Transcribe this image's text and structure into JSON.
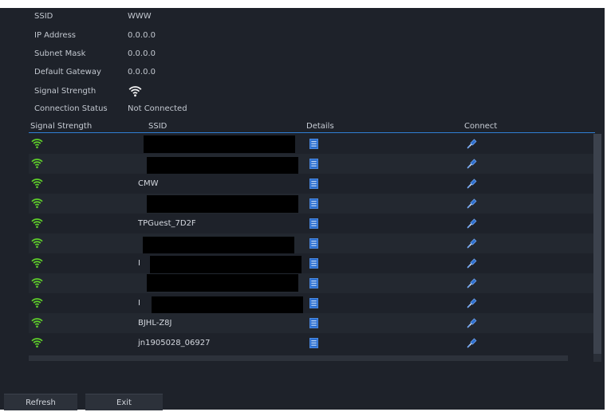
{
  "info": [
    {
      "label": "SSID",
      "value": "WWW"
    },
    {
      "label": "IP Address",
      "value": "0.0.0.0"
    },
    {
      "label": "Subnet Mask",
      "value": "0.0.0.0"
    },
    {
      "label": "Default Gateway",
      "value": "0.0.0.0"
    },
    {
      "label": "Signal Strength",
      "value": ""
    },
    {
      "label": "Connection Status",
      "value": "Not Connected"
    }
  ],
  "table": {
    "columns": [
      "Signal Strength",
      "SSID",
      "Details",
      "Connect"
    ],
    "rows": [
      {
        "ssid": "",
        "redacted": true
      },
      {
        "ssid": "",
        "redacted": true
      },
      {
        "ssid": "CMW",
        "redacted": false
      },
      {
        "ssid": "",
        "redacted": true
      },
      {
        "ssid": "TPGuest_7D2F",
        "redacted": false
      },
      {
        "ssid": "",
        "redacted": true
      },
      {
        "ssid": "I",
        "redacted": true
      },
      {
        "ssid": "",
        "redacted": true
      },
      {
        "ssid": "I",
        "redacted": true
      },
      {
        "ssid": "BJHL-Z8J",
        "redacted": false
      },
      {
        "ssid": "jn1905028_06927",
        "redacted": false
      }
    ]
  },
  "buttons": {
    "refresh": "Refresh",
    "exit": "Exit"
  },
  "colors": {
    "accent": "#2f7fd4",
    "wifi_green": "#5fd12a",
    "icon_blue": "#2d6fcf"
  }
}
